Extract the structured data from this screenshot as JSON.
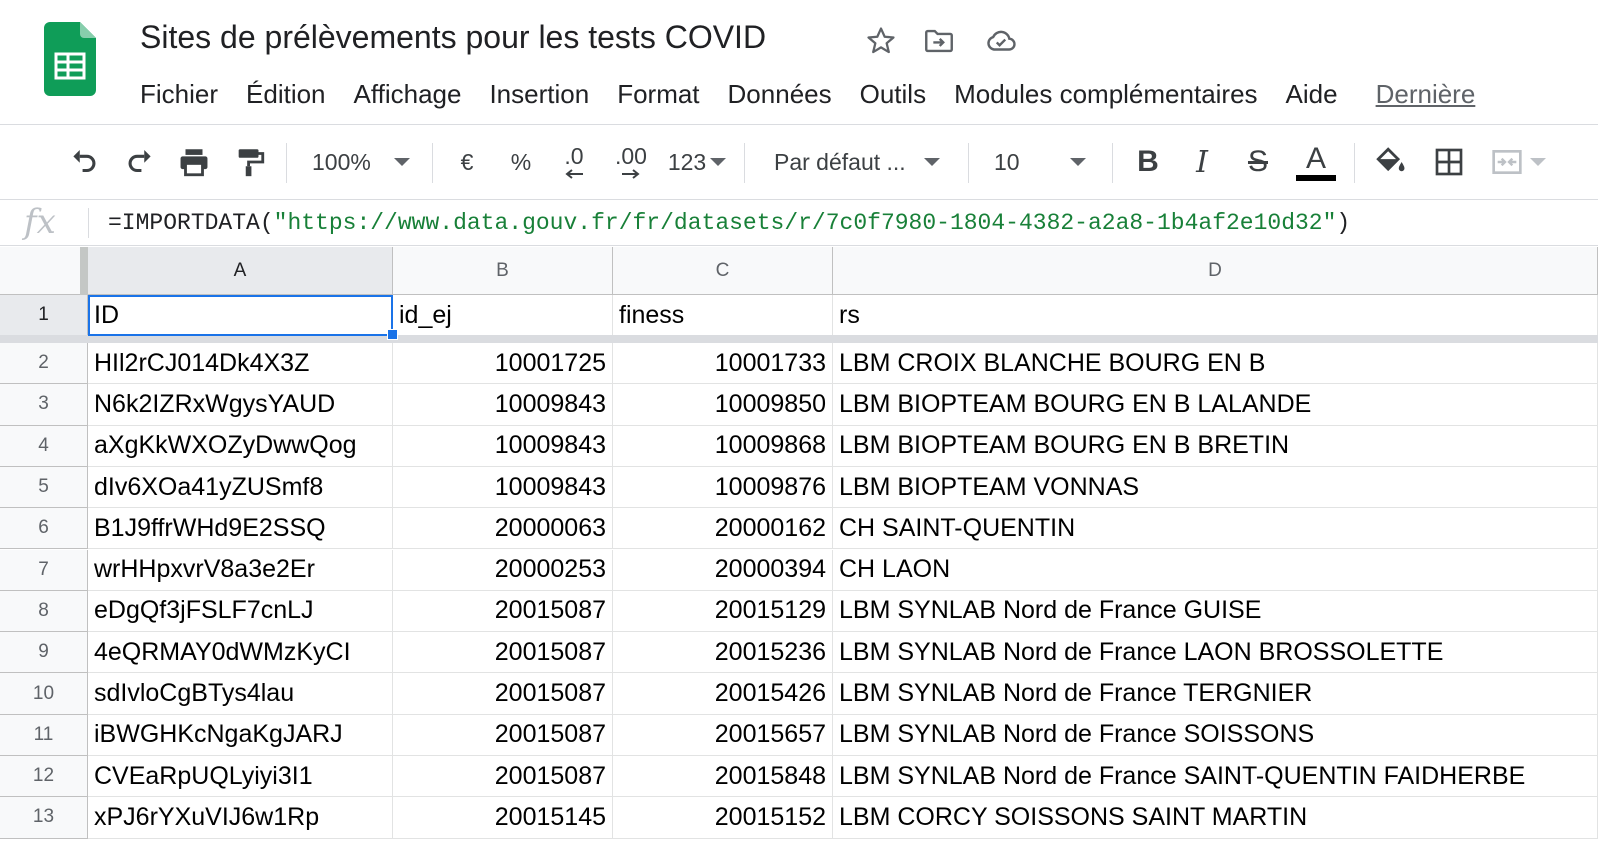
{
  "app": {
    "doc_title": "Sites de prélèvements pour les tests COVID",
    "accent_color": "#0f9d58"
  },
  "title_icons": [
    "star-icon",
    "move-to-folder-icon",
    "cloud-saved-icon"
  ],
  "menu": {
    "items": [
      "Fichier",
      "Édition",
      "Affichage",
      "Insertion",
      "Format",
      "Données",
      "Outils",
      "Modules complémentaires",
      "Aide"
    ],
    "last_edit": "Dernière"
  },
  "toolbar": {
    "zoom": "100%",
    "currency": "€",
    "percent": "%",
    "decrease_decimal": ".0",
    "increase_decimal": ".00",
    "more_formats": "123",
    "font": "Par défaut ...",
    "font_size": "10",
    "bold": "B",
    "italic": "I",
    "strikethrough": "S",
    "text_color_letter": "A"
  },
  "formula_bar": {
    "fx": "fx",
    "prefix": "=IMPORTDATA(",
    "url": "\"https://www.data.gouv.fr/fr/datasets/r/7c0f7980-1804-4382-a2a8-1b4af2e10d32\"",
    "suffix": ")"
  },
  "grid": {
    "columns": [
      "A",
      "B",
      "C",
      "D"
    ],
    "header_row": {
      "row": "1",
      "cells": [
        "ID",
        "id_ej",
        "finess",
        "rs"
      ]
    },
    "rows": [
      {
        "row": "2",
        "cells": [
          "HIl2rCJ014Dk4X3Z",
          "10001725",
          "10001733",
          "LBM CROIX BLANCHE BOURG EN B"
        ]
      },
      {
        "row": "3",
        "cells": [
          "N6k2IZRxWgysYAUD",
          "10009843",
          "10009850",
          "LBM BIOPTEAM BOURG EN B LALANDE"
        ]
      },
      {
        "row": "4",
        "cells": [
          "aXgKkWXOZyDwwQog",
          "10009843",
          "10009868",
          "LBM BIOPTEAM BOURG EN B BRETIN"
        ]
      },
      {
        "row": "5",
        "cells": [
          "dIv6XOa41yZUSmf8",
          "10009843",
          "10009876",
          "LBM BIOPTEAM VONNAS"
        ]
      },
      {
        "row": "6",
        "cells": [
          "B1J9ffrWHd9E2SSQ",
          "20000063",
          "20000162",
          "CH SAINT-QUENTIN"
        ]
      },
      {
        "row": "7",
        "cells": [
          "wrHHpxvrV8a3e2Er",
          "20000253",
          "20000394",
          "CH LAON"
        ]
      },
      {
        "row": "8",
        "cells": [
          "eDgQf3jFSLF7cnLJ",
          "20015087",
          "20015129",
          "LBM SYNLAB Nord de France GUISE"
        ]
      },
      {
        "row": "9",
        "cells": [
          "4eQRMAY0dWMzKyCI",
          "20015087",
          "20015236",
          "LBM SYNLAB Nord de France LAON BROSSOLETTE"
        ]
      },
      {
        "row": "10",
        "cells": [
          "sdIvloCgBTys4lau",
          "20015087",
          "20015426",
          "LBM SYNLAB Nord de France TERGNIER"
        ]
      },
      {
        "row": "11",
        "cells": [
          "iBWGHKcNgaKgJARJ",
          "20015087",
          "20015657",
          "LBM SYNLAB Nord de France SOISSONS"
        ]
      },
      {
        "row": "12",
        "cells": [
          "CVEaRpUQLyiyi3I1",
          "20015087",
          "20015848",
          "LBM SYNLAB Nord de France SAINT-QUENTIN FAIDHERBE"
        ]
      },
      {
        "row": "13",
        "cells": [
          "xPJ6rYXuVIJ6w1Rp",
          "20015145",
          "20015152",
          "LBM CORCY SOISSONS SAINT MARTIN"
        ]
      }
    ]
  }
}
